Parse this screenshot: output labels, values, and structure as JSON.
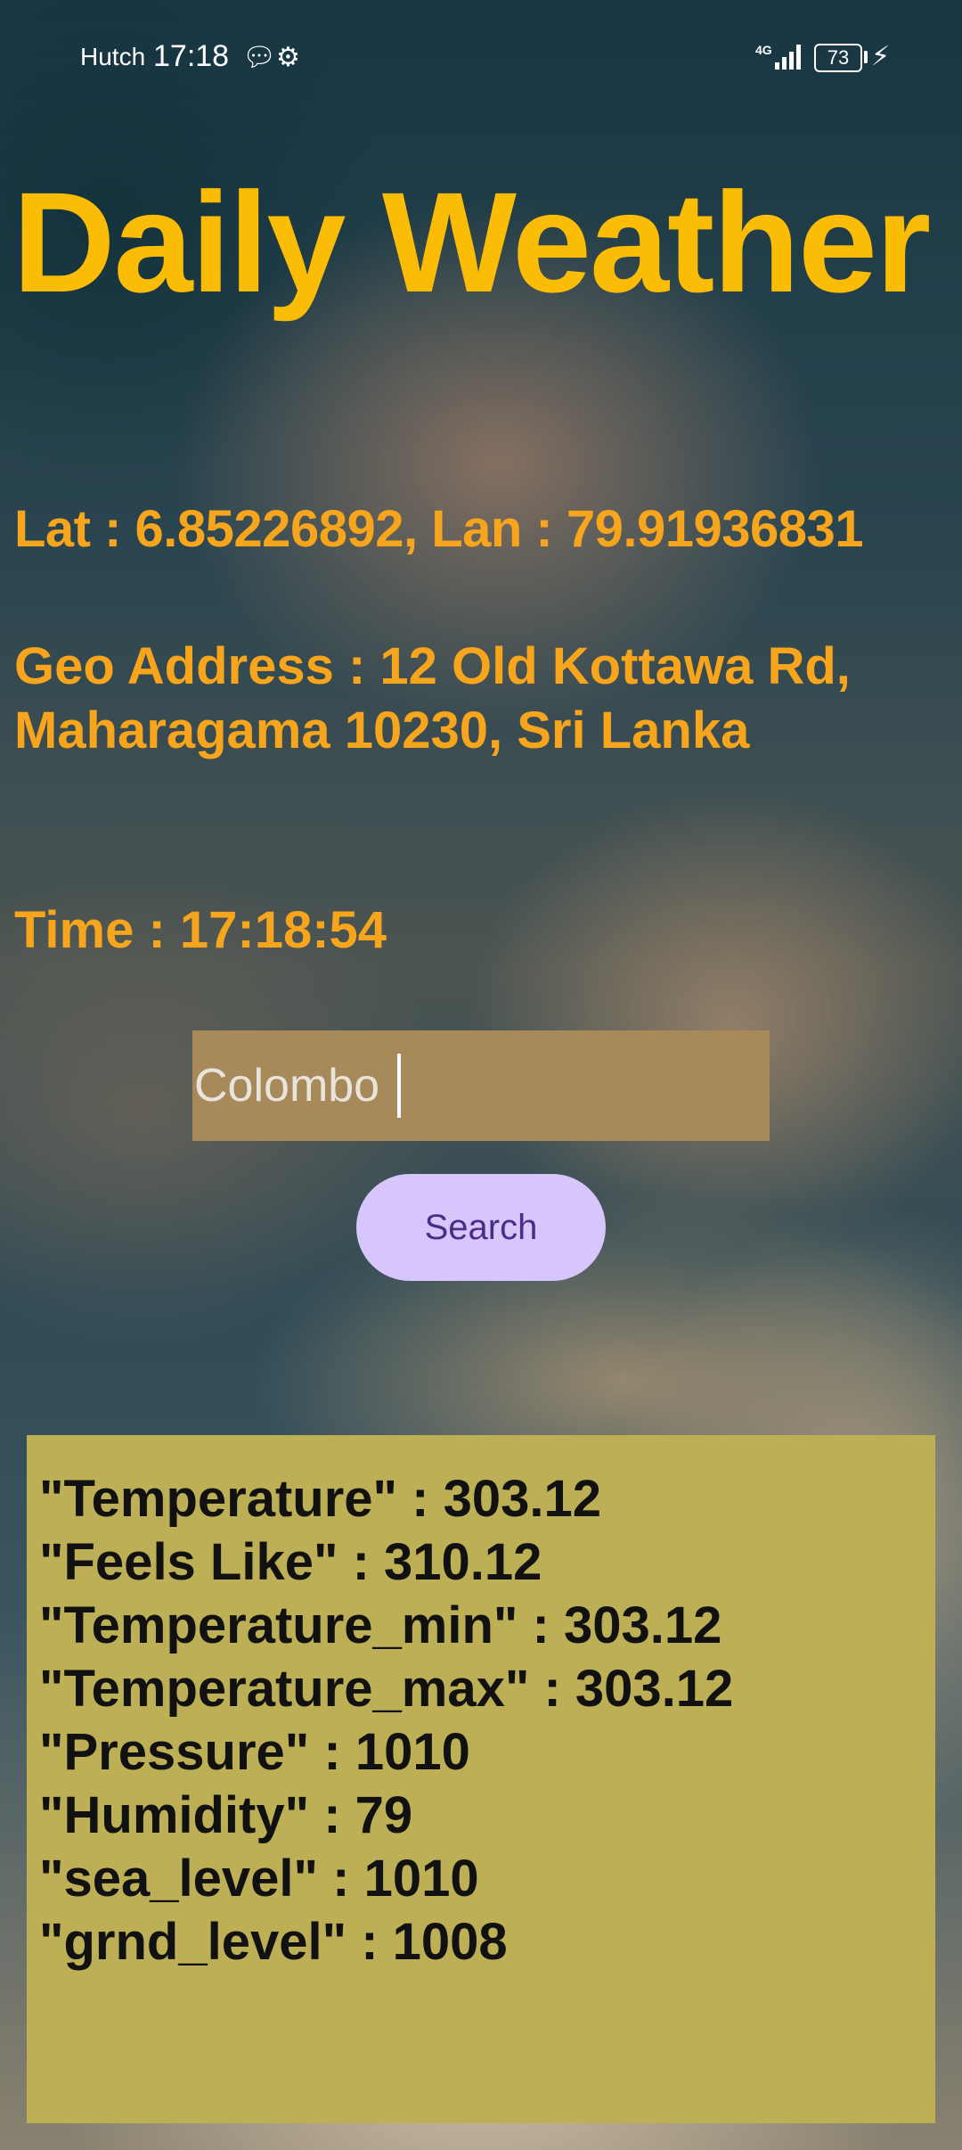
{
  "status_bar": {
    "carrier": "Hutch",
    "time": "17:18",
    "network": "4G",
    "battery": "73",
    "icons": [
      "chat-bubble-icon",
      "settings-gear-icon",
      "signal-icon",
      "battery-icon",
      "charging-bolt-icon"
    ]
  },
  "app": {
    "title": "Daily Weather"
  },
  "location": {
    "latlon": "Lat : 6.85226892, Lan : 79.91936831",
    "geo_address": "Geo Address : 12 Old Kottawa Rd, Maharagama 10230, Sri Lanka",
    "time": "Time : 17:18:54"
  },
  "search": {
    "value": "Colombo",
    "button_label": "Search"
  },
  "result": {
    "lines": [
      "\"Temperature\" : 303.12",
      "\"Feels Like\" : 310.12",
      "\"Temperature_min\" : 303.12",
      "\"Temperature_max\" : 303.12",
      "\"Pressure\" : 1010",
      "\"Humidity\" : 79",
      "\"sea_level\" : 1010",
      "\"grnd_level\" : 1008"
    ]
  },
  "colors": {
    "title": "#fbbc05",
    "info_text": "#f7a51c",
    "input_bg": "#a88a5a",
    "button_bg": "#d6c6fb",
    "button_text": "#4b2d86",
    "result_bg": "#bcaf55"
  }
}
